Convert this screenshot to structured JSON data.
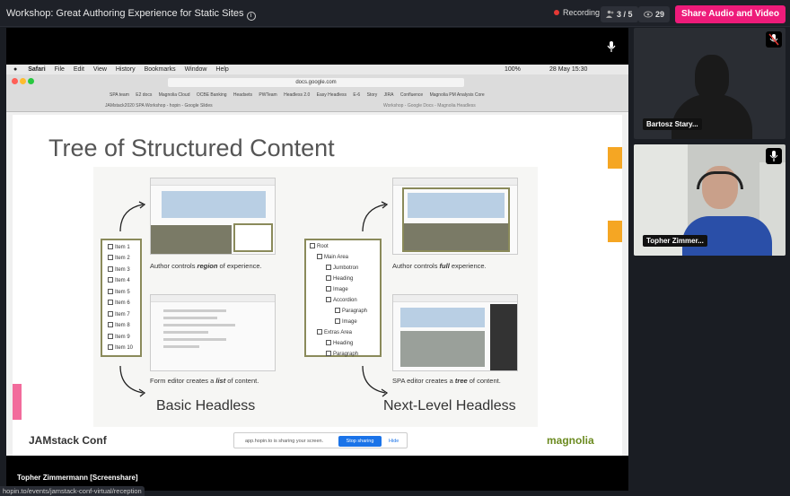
{
  "topbar": {
    "title": "Workshop: Great Authoring Experience for Static Sites",
    "recording_label": "Recording",
    "people_count": "3 / 5",
    "viewers_count": "29",
    "share_button": "Share Audio and Video"
  },
  "screen": {
    "menubar": [
      "Safari",
      "File",
      "Edit",
      "View",
      "History",
      "Bookmarks",
      "Window",
      "Help"
    ],
    "battery": "100%",
    "datetime": "28 May 15:30",
    "url": "docs.google.com",
    "bookmarks": [
      "SPA team",
      "E2 docs",
      "Magnolia Cloud",
      "OCBE Banking",
      "Headsets",
      "PWTeam",
      "Headless 2.0",
      "Easy Headless",
      "E-6",
      "Story",
      "JIRA",
      "Confluence",
      "Magnolia PM Analysis Core"
    ],
    "tab_title": "JAMstack2020 SPA Workshop - hopin - Google Slides",
    "tab_title_right": "Workshop - Google Docs - Magnolia Headless",
    "sharing_text": "app.hopin.to is sharing your screen.",
    "stop_sharing": "Stop sharing",
    "hide": "Hide"
  },
  "slide": {
    "title": "Tree of Structured Content",
    "list_items": [
      "Item 1",
      "Item 2",
      "Item 3",
      "Item 4",
      "Item 5",
      "Item 6",
      "Item 7",
      "Item 8",
      "Item 9",
      "Item 10"
    ],
    "tree_items": [
      "Root",
      "Main Area",
      "Jumbotron",
      "Heading",
      "Image",
      "Accordion",
      "Paragraph",
      "Image",
      "Extras Area",
      "Heading",
      "Paragraph"
    ],
    "caption_region_prefix": "Author controls ",
    "caption_region_em": "region",
    "caption_region_suffix": " of experience.",
    "caption_list_prefix": "Form editor creates a ",
    "caption_list_em": "list",
    "caption_list_suffix": " of content.",
    "caption_full_prefix": "Author controls ",
    "caption_full_em": "full",
    "caption_full_suffix": " experience.",
    "caption_tree_prefix": "SPA editor creates a ",
    "caption_tree_em": "tree",
    "caption_tree_suffix": " of content.",
    "heading_left": "Basic Headless",
    "heading_right": "Next-Level Headless",
    "logo_left": "JAMstack Conf",
    "logo_right": "magnolia"
  },
  "stage_caption": "Topher Zimmermann [Screenshare]",
  "status_url": "hopin.to/events/jamstack-conf-virtual/reception",
  "participants": [
    {
      "name": "Bartosz Stary..."
    },
    {
      "name": "Topher Zimmer..."
    }
  ],
  "colors": {
    "accent": "#ee1b7a",
    "record": "#e53935",
    "olive": "#8a8a5a"
  }
}
